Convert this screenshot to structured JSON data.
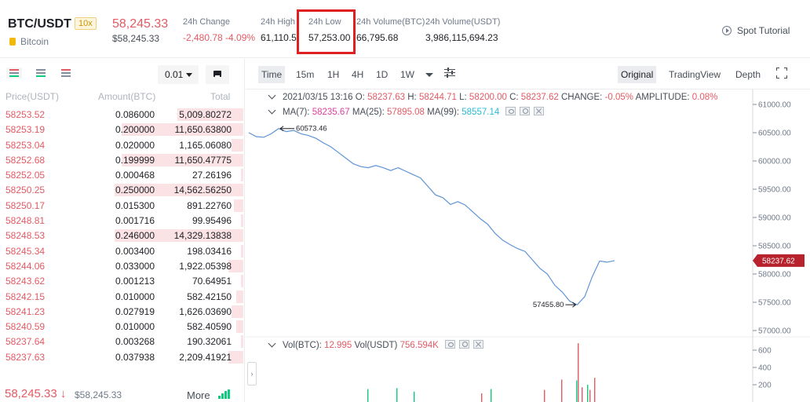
{
  "header": {
    "pair": "BTC/USDT",
    "leverage": "10x",
    "coin_name": "Bitcoin",
    "last_price": "58,245.33",
    "last_price_usd": "$58,245.33",
    "stats": [
      {
        "label": "24h Change",
        "value": "-2,480.78 -4.09%",
        "color": "red"
      },
      {
        "label": "24h High",
        "value": "61,110.5"
      },
      {
        "label": "24h Low",
        "value": "57,253.00",
        "highlighted": true
      },
      {
        "label": "24h Volume(BTC)",
        "value": "66,795.68"
      },
      {
        "label": "24h Volume(USDT)",
        "value": "3,986,115,694.23"
      }
    ],
    "spot_tutorial": "Spot Tutorial"
  },
  "order_book": {
    "precision": "0.01",
    "columns": [
      "Price(USDT)",
      "Amount(BTC)",
      "Total"
    ],
    "asks": [
      {
        "price": "58253.52",
        "amount": "0.086000",
        "total": "5,009.80272",
        "depth": 0.27
      },
      {
        "price": "58253.19",
        "amount": "0.200000",
        "total": "11,650.63800",
        "depth": 0.5
      },
      {
        "price": "58253.04",
        "amount": "0.020000",
        "total": "1,165.06080",
        "depth": 0.05
      },
      {
        "price": "58252.68",
        "amount": "0.199999",
        "total": "11,650.47775",
        "depth": 0.5
      },
      {
        "price": "58252.05",
        "amount": "0.000468",
        "total": "27.26196",
        "depth": 0.01
      },
      {
        "price": "58250.25",
        "amount": "0.250000",
        "total": "14,562.56250",
        "depth": 0.53
      },
      {
        "price": "58250.17",
        "amount": "0.015300",
        "total": "891.22760",
        "depth": 0.04
      },
      {
        "price": "58248.81",
        "amount": "0.001716",
        "total": "99.95496",
        "depth": 0.01
      },
      {
        "price": "58248.53",
        "amount": "0.246000",
        "total": "14,329.13838",
        "depth": 0.53
      },
      {
        "price": "58245.34",
        "amount": "0.003400",
        "total": "198.03416",
        "depth": 0.01
      },
      {
        "price": "58244.06",
        "amount": "0.033000",
        "total": "1,922.05398",
        "depth": 0.06
      },
      {
        "price": "58243.62",
        "amount": "0.001213",
        "total": "70.64951",
        "depth": 0.01
      },
      {
        "price": "58242.15",
        "amount": "0.010000",
        "total": "582.42150",
        "depth": 0.03
      },
      {
        "price": "58241.23",
        "amount": "0.027919",
        "total": "1,626.03690",
        "depth": 0.05
      },
      {
        "price": "58240.59",
        "amount": "0.010000",
        "total": "582.40590",
        "depth": 0.03
      },
      {
        "price": "58237.64",
        "amount": "0.003268",
        "total": "190.32061",
        "depth": 0.01
      },
      {
        "price": "58237.63",
        "amount": "0.037938",
        "total": "2,209.41921",
        "depth": 0.06
      }
    ],
    "last_price": "58,245.33 ↓",
    "last_price_usd": "$58,245.33",
    "more": "More"
  },
  "chart_panel": {
    "timeframes": [
      "Time",
      "15m",
      "1H",
      "4H",
      "1D",
      "1W"
    ],
    "active_timeframe": "Time",
    "views": [
      "Original",
      "TradingView",
      "Depth"
    ],
    "active_view": "Original",
    "ohlc": {
      "date": "2021/03/15 13:16",
      "o_label": "O:",
      "o": "58237.63",
      "h_label": "H:",
      "h": "58244.71",
      "l_label": "L:",
      "l": "58200.00",
      "c_label": "C:",
      "c": "58237.62",
      "change_label": "CHANGE:",
      "change": "-0.05%",
      "amp_label": "AMPLITUDE:",
      "amp": "0.08%"
    },
    "ma": [
      {
        "label": "MA(7):",
        "value": "58235.67",
        "color": "#e0409f"
      },
      {
        "label": "MA(25):",
        "value": "57895.08",
        "color": "#e15b64"
      },
      {
        "label": "MA(99):",
        "value": "58557.14",
        "color": "#2bbcd4"
      }
    ],
    "vol": {
      "btc_label": "Vol(BTC):",
      "btc": "12.995",
      "usdt_label": "Vol(USDT)",
      "usdt": "756.594K"
    },
    "line_color": "#5f94d6",
    "current_price_tag": "58237.62",
    "high_marker": "60573.46",
    "low_marker": "57455.80",
    "vol_axis_ticks": [
      "600",
      "400",
      "200"
    ]
  },
  "chart_data": {
    "type": "line",
    "ylim": [
      57000,
      61000
    ],
    "y_ticks": [
      "61000.00",
      "60500.00",
      "60000.00",
      "59500.00",
      "59000.00",
      "58500.00",
      "58000.00",
      "57500.00",
      "57000.00"
    ],
    "y_tick_values": [
      61000,
      60500,
      60000,
      59500,
      59000,
      58500,
      58000,
      57500,
      57000
    ],
    "values": [
      60500,
      60430,
      60420,
      60480,
      60573,
      60520,
      60540,
      60480,
      60450,
      60400,
      60320,
      60250,
      60150,
      60050,
      59950,
      59900,
      59880,
      59920,
      59880,
      59830,
      59880,
      59820,
      59760,
      59700,
      59550,
      59400,
      59350,
      59230,
      59280,
      59220,
      59100,
      58980,
      58880,
      58720,
      58600,
      58520,
      58450,
      58400,
      58250,
      58100,
      58000,
      57800,
      57680,
      57520,
      57456,
      57600,
      57950,
      58230,
      58210,
      58238
    ]
  }
}
